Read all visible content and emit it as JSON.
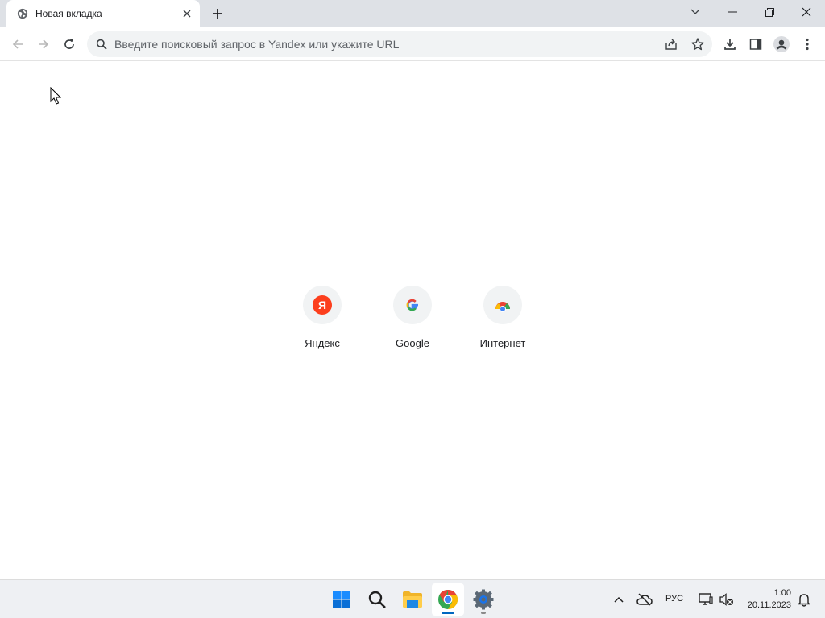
{
  "browser": {
    "tab": {
      "title": "Новая вкладка",
      "favicon": "globe-icon"
    },
    "new_tab_icon": "plus-icon",
    "window_controls": [
      "chevron-down-icon",
      "minimize-icon",
      "restore-icon",
      "close-icon"
    ]
  },
  "toolbar": {
    "back_icon": "arrow-left-icon",
    "forward_icon": "arrow-right-icon",
    "reload_icon": "reload-icon",
    "omnibox": {
      "placeholder": "Введите поисковый запрос в Yandex или укажите URL",
      "search_icon": "search-icon"
    },
    "right_icons": [
      "share-icon",
      "star-icon",
      "download-icon",
      "side-panel-icon",
      "profile-icon",
      "more-vert-icon"
    ]
  },
  "shortcuts": [
    {
      "label": "Яндекс",
      "icon": "yandex-icon",
      "color": "#fc3f1d",
      "glyph": "Я"
    },
    {
      "label": "Google",
      "icon": "google-icon",
      "color": "#4285f4",
      "glyph": "G"
    },
    {
      "label": "Интернет",
      "icon": "chrome-web-store-icon",
      "color": "#34a853"
    }
  ],
  "taskbar": {
    "apps": [
      {
        "name": "start",
        "icon": "windows-start-icon",
        "active": false
      },
      {
        "name": "search",
        "icon": "search-icon",
        "active": false
      },
      {
        "name": "explorer",
        "icon": "folder-icon",
        "active": false
      },
      {
        "name": "chrome",
        "icon": "chrome-icon",
        "active": true
      },
      {
        "name": "settings",
        "icon": "gear-icon",
        "active": false
      }
    ],
    "tray": {
      "language": "РУС",
      "time": "1:00",
      "date": "20.11.2023"
    }
  },
  "colors": {
    "accent": "#0067c0",
    "tabstrip": "#dee1e6",
    "omnibox": "#f1f3f4"
  }
}
